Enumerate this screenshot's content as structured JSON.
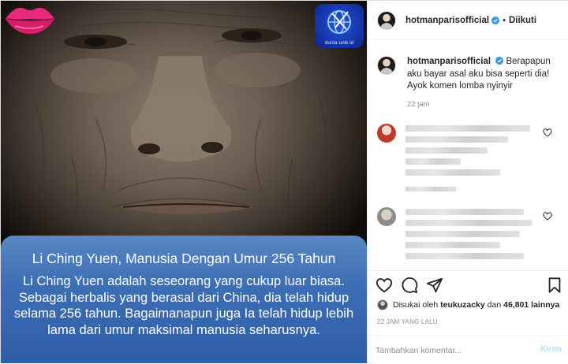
{
  "post": {
    "username": "hotmanparisofficial",
    "follow_status": "Diikuti",
    "separator": "•"
  },
  "media": {
    "badge_text": "dunia unik.id",
    "card_title": "Li Ching Yuen, Manusia Dengan Umur 256 Tahun",
    "card_body": "Li Ching Yuen adalah seseorang yang cukup luar biasa. Sebagai herbalis yang berasal dari China, dia telah hidup selama 256 tahun. Bagaimanapun juga Ia telah hidup lebih lama dari umur maksimal manusia seharusnya."
  },
  "caption": {
    "username": "hotmanparisofficial",
    "text": "Berapapun aku bayar asal aku bisa seperti dia! Ayok komen lomba nyinyir",
    "time": "22 jam"
  },
  "likes": {
    "prefix": "Disukai oleh",
    "user": "teukuzacky",
    "conjunction": "dan",
    "count": "46,801",
    "suffix": "lainnya"
  },
  "timestamp": "22 JAM YANG LALU",
  "comment_box": {
    "placeholder": "Tambahkan komentar...",
    "post_label": "Kirim"
  },
  "icons": {
    "like": "heart-icon",
    "comment": "comment-icon",
    "share": "paper-plane-icon",
    "save": "bookmark-icon",
    "verified": "verified-badge-icon"
  },
  "colors": {
    "verified": "#3897f0",
    "card_blue": "#3c6eb4",
    "post_button_disabled": "#b2dffc",
    "muted_text": "#8e8e8e"
  }
}
